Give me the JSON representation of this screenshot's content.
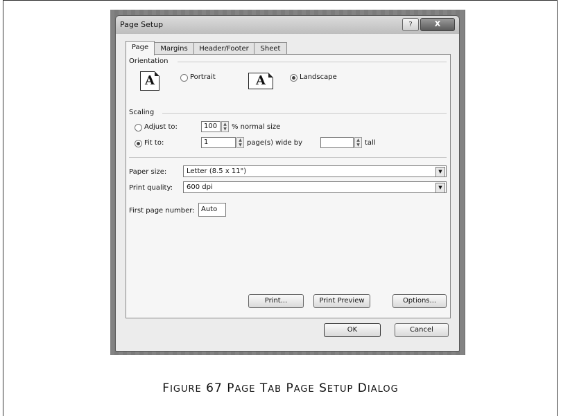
{
  "dialog": {
    "title": "Page Setup",
    "help_label": "?",
    "close_label": "X",
    "tabs": [
      "Page",
      "Margins",
      "Header/Footer",
      "Sheet"
    ],
    "orientation": {
      "label": "Orientation",
      "portrait_label": "Portrait",
      "landscape_label": "Landscape",
      "selected": "Landscape",
      "icon_glyph": "A"
    },
    "scaling": {
      "label": "Scaling",
      "adjust_label": "Adjust to:",
      "adjust_value": "100",
      "adjust_suffix": "% normal size",
      "fit_label": "Fit to:",
      "fit_wide_value": "1",
      "fit_wide_suffix": "page(s) wide by",
      "fit_tall_value": "",
      "fit_tall_suffix": "tall",
      "selected": "Fit to:"
    },
    "paper_size": {
      "label": "Paper size:",
      "value": "Letter (8.5 x 11\")"
    },
    "print_quality": {
      "label": "Print quality:",
      "value": "600 dpi"
    },
    "first_page": {
      "label": "First page number:",
      "value": "Auto"
    },
    "buttons": {
      "print": "Print...",
      "print_preview": "Print Preview",
      "options": "Options...",
      "ok": "OK",
      "cancel": "Cancel"
    }
  },
  "caption": {
    "first": "F",
    "first_rest": "IGURE",
    "number": "67",
    "w1": "P",
    "w1_rest": "AGE",
    "w2": "T",
    "w2_rest": "AB",
    "w3": "P",
    "w3_rest": "AGE",
    "w4": "S",
    "w4_rest": "ETUP",
    "w5": "D",
    "w5_rest": "IALOG"
  }
}
